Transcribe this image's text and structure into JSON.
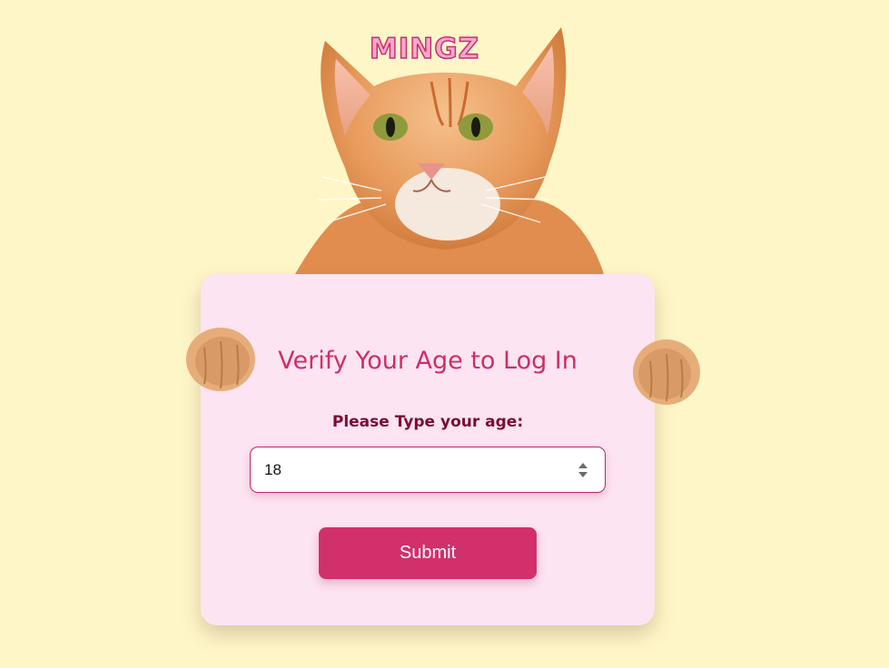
{
  "logo": {
    "text": "MINGZ"
  },
  "card": {
    "title": "Verify Your Age to Log In",
    "age_label": "Please Type your age:",
    "age_value": "18",
    "submit_label": "Submit"
  },
  "colors": {
    "background": "#fff6c8",
    "card": "#fde4f2",
    "accent": "#d1306b",
    "title": "#cf2e66",
    "label": "#7a0d33"
  },
  "icons": {
    "cat": "cat-illustration",
    "paw": "paw-icon",
    "spinner": "number-spinner-icon"
  }
}
